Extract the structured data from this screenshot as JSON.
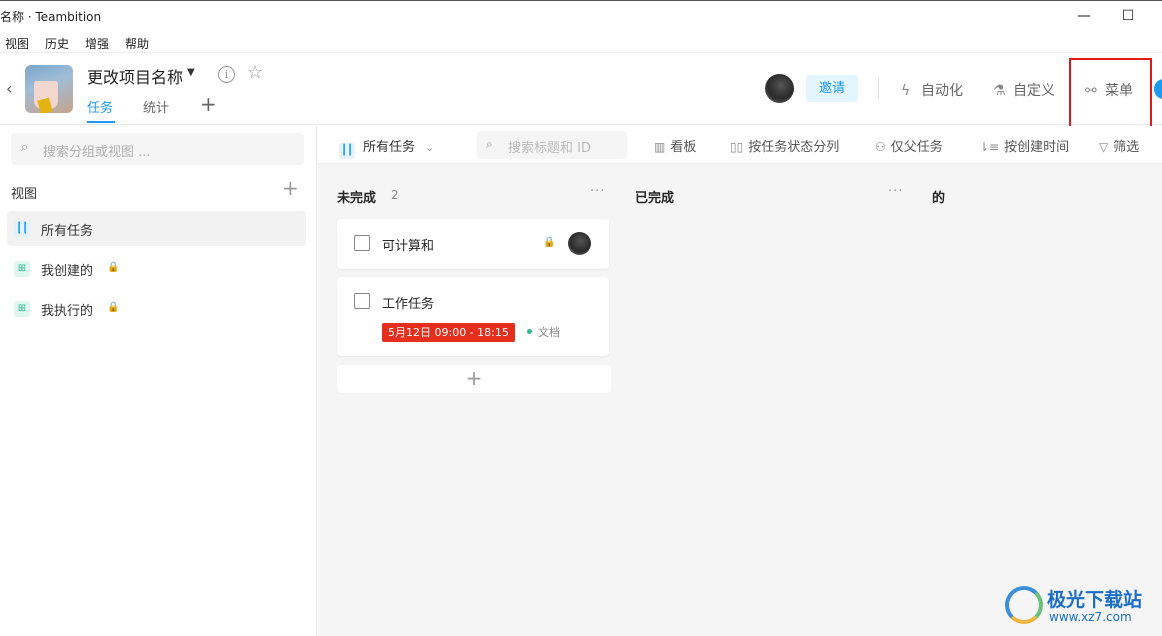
{
  "window": {
    "title": "名称 · Teambition",
    "minimize": "—",
    "maximize": "☐"
  },
  "menu": [
    "视图",
    "历史",
    "增强",
    "帮助"
  ],
  "header": {
    "back": "‹",
    "project_title": "更改项目名称",
    "caret": "▼",
    "info": "i",
    "star": "☆",
    "tabs": [
      {
        "label": "任务",
        "active": true
      },
      {
        "label": "统计",
        "active": false
      }
    ],
    "add_tab": "+",
    "invite_label": "邀请",
    "automation_label": "自动化",
    "custom_label": "自定义",
    "menu_label": "菜单",
    "automation_icon": "ϟ",
    "custom_icon": "⚗",
    "menu_icon": "⚯"
  },
  "sidebar": {
    "search_icon": "⌕",
    "search_placeholder": "搜索分组或视图 ...",
    "section_title": "视图",
    "add": "+",
    "items": [
      {
        "label": "所有任务",
        "icon": "┃┃",
        "active": true,
        "locked": false
      },
      {
        "label": "我创建的",
        "icon": "⊞",
        "active": false,
        "locked": true
      },
      {
        "label": "我执行的",
        "icon": "⊞",
        "active": false,
        "locked": true
      }
    ],
    "lock": "🔒"
  },
  "toolbar": {
    "all_tasks": "所有任务",
    "all_icon": "┃┃",
    "chevron": "⌄",
    "search_icon": "⌕",
    "search_placeholder": "搜索标题和 ID",
    "board": "看板",
    "board_icon": "▥",
    "group_by_status": "按任务状态分列",
    "group_icon": "▯▯",
    "parent_only": "仅父任务",
    "parent_icon": "⚇",
    "sort_created": "按创建时间",
    "sort_icon": "⇂≡",
    "filter": "筛选",
    "filter_icon": "▽"
  },
  "board": {
    "columns": [
      {
        "title": "未完成",
        "count": "2",
        "more": "···"
      },
      {
        "title": "已完成",
        "more": "···"
      },
      {
        "title": "的"
      }
    ],
    "cards": [
      {
        "title": "可计算和",
        "lock": "🔒"
      },
      {
        "title": "工作任务",
        "due": "5月12日 09:00 - 18:15",
        "tag": "文档"
      }
    ],
    "add_card": "+"
  },
  "watermark": {
    "title": "极光下载站",
    "url": "www.xz7.com"
  },
  "colors": {
    "accent": "#1b9aee",
    "due_red": "#e62e1c",
    "highlight_red": "#e0191b",
    "tag_green": "#2bbd91"
  }
}
